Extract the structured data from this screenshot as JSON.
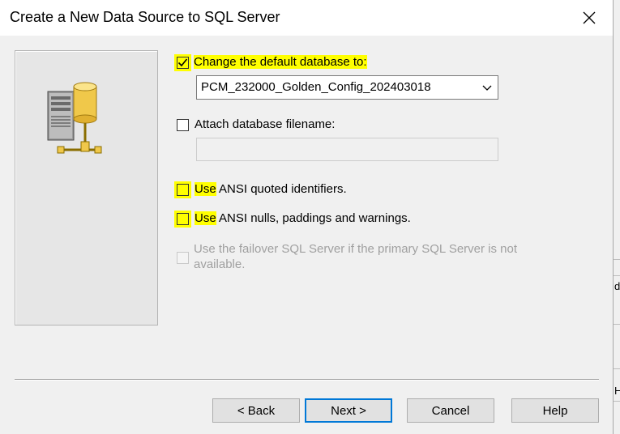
{
  "window": {
    "title": "Create a New Data Source to SQL Server",
    "close_icon": "close-icon"
  },
  "options": {
    "change_default_db": {
      "checked": true,
      "label_hl": "Change the default database to:",
      "label_rest": ""
    },
    "default_db_select": {
      "value": "PCM_232000_Golden_Config_202403018"
    },
    "attach_db_filename": {
      "checked": false,
      "label": "Attach database filename:",
      "value": ""
    },
    "ansi_quoted": {
      "checked": false,
      "label_hl": "Use",
      "label_rest": " ANSI quoted identifiers."
    },
    "ansi_nulls": {
      "checked": false,
      "label_hl": "Use",
      "label_rest": " ANSI nulls, paddings and warnings."
    },
    "failover": {
      "checked": false,
      "disabled": true,
      "label": "Use the failover SQL Server if the primary SQL Server is not available."
    }
  },
  "buttons": {
    "back": "< Back",
    "next": "Next >",
    "cancel": "Cancel",
    "help": "Help"
  },
  "background_fragment": {
    "text_1": "de",
    "text_2": "H"
  },
  "colors": {
    "highlight": "#ffff00",
    "default_button_border": "#0078d7",
    "dialog_bg": "#f0f0f0"
  }
}
